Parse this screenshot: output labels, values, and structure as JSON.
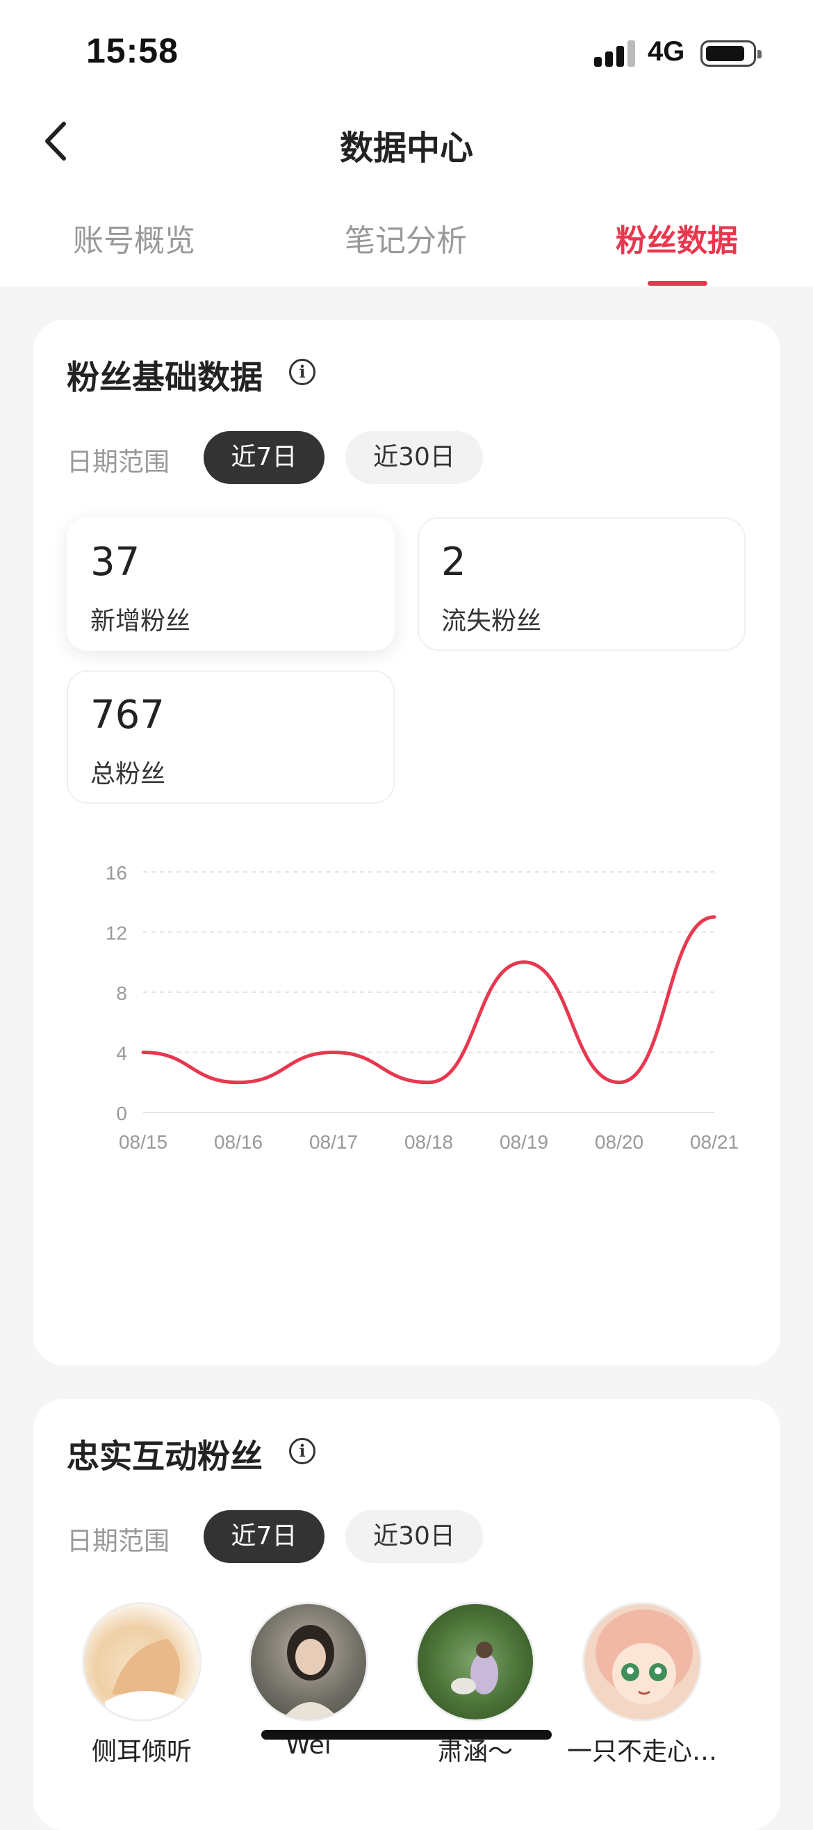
{
  "status_bar": {
    "time": "15:58",
    "network": "4G"
  },
  "header": {
    "title": "数据中心"
  },
  "tabs": [
    {
      "label": "账号概览",
      "active": false
    },
    {
      "label": "笔记分析",
      "active": false
    },
    {
      "label": "粉丝数据",
      "active": true
    }
  ],
  "basic_card": {
    "title": "粉丝基础数据",
    "range_label": "日期范围",
    "ranges": [
      "近7日",
      "近30日"
    ],
    "selected_range": "近7日",
    "stats": [
      {
        "value": "37",
        "label": "新增粉丝",
        "selected": true
      },
      {
        "value": "2",
        "label": "流失粉丝",
        "selected": false
      },
      {
        "value": "767",
        "label": "总粉丝",
        "selected": false
      }
    ]
  },
  "chart_data": {
    "type": "line",
    "categories": [
      "08/15",
      "08/16",
      "08/17",
      "08/18",
      "08/19",
      "08/20",
      "08/21"
    ],
    "values": [
      4,
      2,
      4,
      2,
      10,
      2,
      13
    ],
    "ylim": [
      0,
      16
    ],
    "yticks": [
      "0",
      "4",
      "8",
      "12",
      "16"
    ],
    "grid": true,
    "line_color": "#e8384f"
  },
  "loyal_card": {
    "title": "忠实互动粉丝",
    "range_label": "日期范围",
    "ranges": [
      "近7日",
      "近30日"
    ],
    "selected_range": "近7日",
    "fans": [
      {
        "name": "侧耳倾听"
      },
      {
        "name": "Wei"
      },
      {
        "name": "肃涵～"
      },
      {
        "name": "一只不走心…"
      }
    ]
  },
  "colors": {
    "accent": "#e8384f",
    "pill_active": "#333333"
  }
}
